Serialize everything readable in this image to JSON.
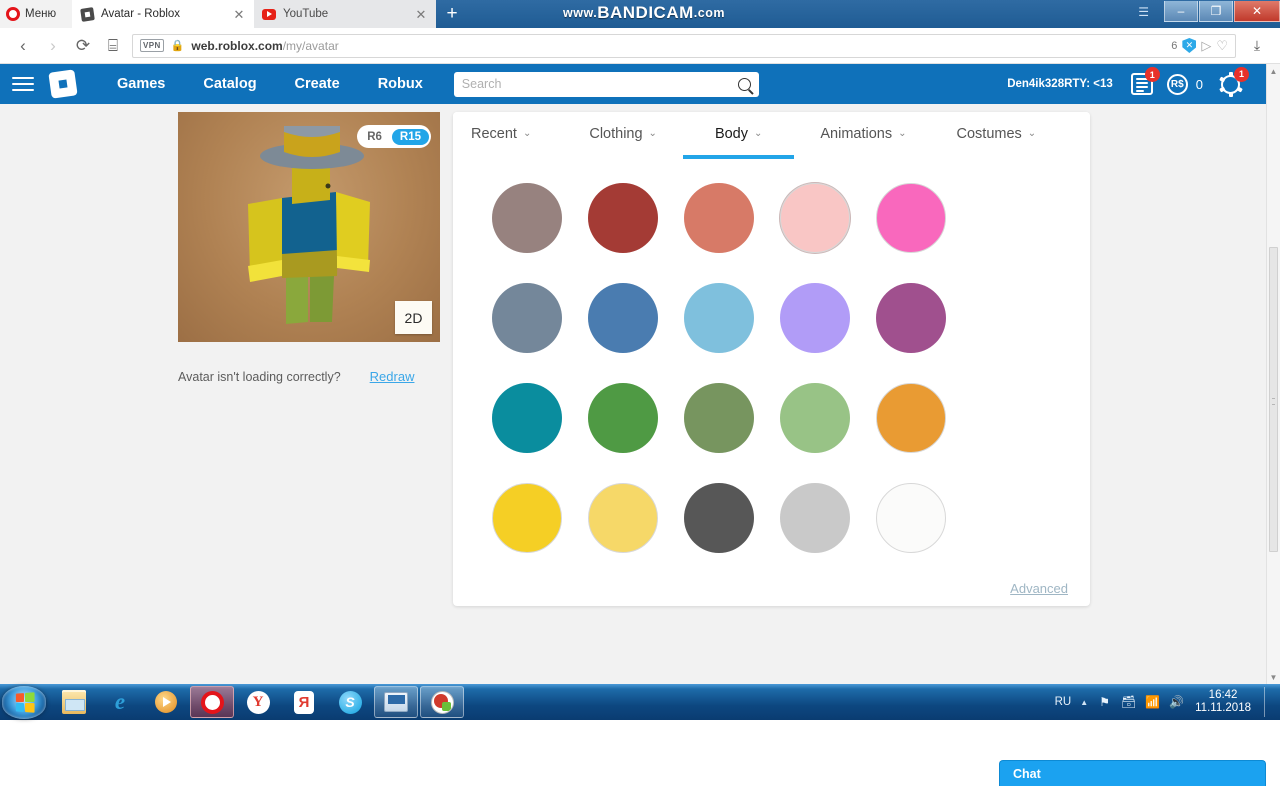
{
  "window": {
    "recorder_watermark_main": "BANDICAM",
    "recorder_watermark_prefix": "www.",
    "recorder_watermark_suffix": ".com",
    "minimize_label": "–",
    "restore_label": "❐",
    "close_label": "✕",
    "menu_arrow": "☰"
  },
  "browser": {
    "opera_menu_label": "Меню",
    "tabs": [
      {
        "title": "Avatar - Roblox",
        "close": "✕",
        "favicon": "roblox-favicon",
        "active": true
      },
      {
        "title": "YouTube",
        "close": "✕",
        "favicon": "youtube-favicon",
        "active": false
      }
    ],
    "new_tab_label": "+",
    "back_label": "‹",
    "forward_label": "›",
    "reload_label": "⟳",
    "speeddial_label": "⌸",
    "vpn_label": "VPN",
    "lock_label": "🔒",
    "url_host": "web.roblox.com",
    "url_path": "/my/avatar",
    "ad_block_count": "6",
    "shield_label": "✕",
    "send_label": "▷",
    "heart_label": "♡",
    "download_label": "⤓"
  },
  "roblox_header": {
    "menu_label": "menu",
    "logo_label": "roblox-logo",
    "nav": [
      {
        "label": "Games"
      },
      {
        "label": "Catalog"
      },
      {
        "label": "Create"
      },
      {
        "label": "Robux"
      }
    ],
    "search_placeholder": "Search",
    "search_value": "",
    "search_icon": "search-icon",
    "username": "Den4ik328RTY: <13",
    "messages_badge": "1",
    "robux_symbol": "R$",
    "robux_count": "0",
    "settings_badge": "1"
  },
  "avatar_panel": {
    "rig_options": [
      {
        "label": "R6",
        "selected": false
      },
      {
        "label": "R15",
        "selected": true
      }
    ],
    "view_toggle_label": "2D",
    "loading_question": "Avatar isn't loading correctly?",
    "redraw_label": "Redraw"
  },
  "picker": {
    "tabs": [
      {
        "label": "Recent",
        "caret": "⌄",
        "active": false
      },
      {
        "label": "Clothing",
        "caret": "⌄",
        "active": false
      },
      {
        "label": "Body",
        "caret": "⌄",
        "active": true
      },
      {
        "label": "Animations",
        "caret": "⌄",
        "active": false
      },
      {
        "label": "Costumes",
        "caret": "⌄",
        "active": false
      }
    ],
    "advanced_label": "Advanced",
    "accent_color": "#22a5e8",
    "swatch_rows": [
      {
        "clipped": true,
        "colors": [
          "#2b1d12",
          "#54301c",
          "#8aa8b8",
          "#d9c79a",
          "#ded0a4"
        ]
      },
      {
        "clipped": false,
        "colors": [
          "#97827f",
          "#a43b35",
          "#d77a67",
          "#f9c6c5",
          "#f968bd"
        ]
      },
      {
        "clipped": false,
        "colors": [
          "#74879a",
          "#4a7cb0",
          "#7fc0dd",
          "#b19cf7",
          "#a0508e"
        ]
      },
      {
        "clipped": false,
        "colors": [
          "#0a8d9e",
          "#4f9a44",
          "#77955f",
          "#98c386",
          "#e99b33"
        ]
      },
      {
        "clipped": false,
        "colors": [
          "#f5cf25",
          "#f6d868",
          "#575757",
          "#c9c9c9",
          "#fbfbfa"
        ]
      }
    ]
  },
  "chat": {
    "label": "Chat"
  },
  "taskbar": {
    "start_label": "start-orb",
    "buttons": [
      {
        "name": "explorer",
        "open": false
      },
      {
        "name": "internet-explorer",
        "open": false
      },
      {
        "name": "windows-media-player",
        "open": false
      },
      {
        "name": "opera",
        "open": true
      },
      {
        "name": "yandex-browser",
        "open": false
      },
      {
        "name": "yandex",
        "open": false
      },
      {
        "name": "skype",
        "open": false
      },
      {
        "name": "remote-desktop",
        "open": true
      },
      {
        "name": "bandicam",
        "open": true
      }
    ],
    "language": "RU",
    "time": "16:42",
    "date": "11.11.2018"
  }
}
